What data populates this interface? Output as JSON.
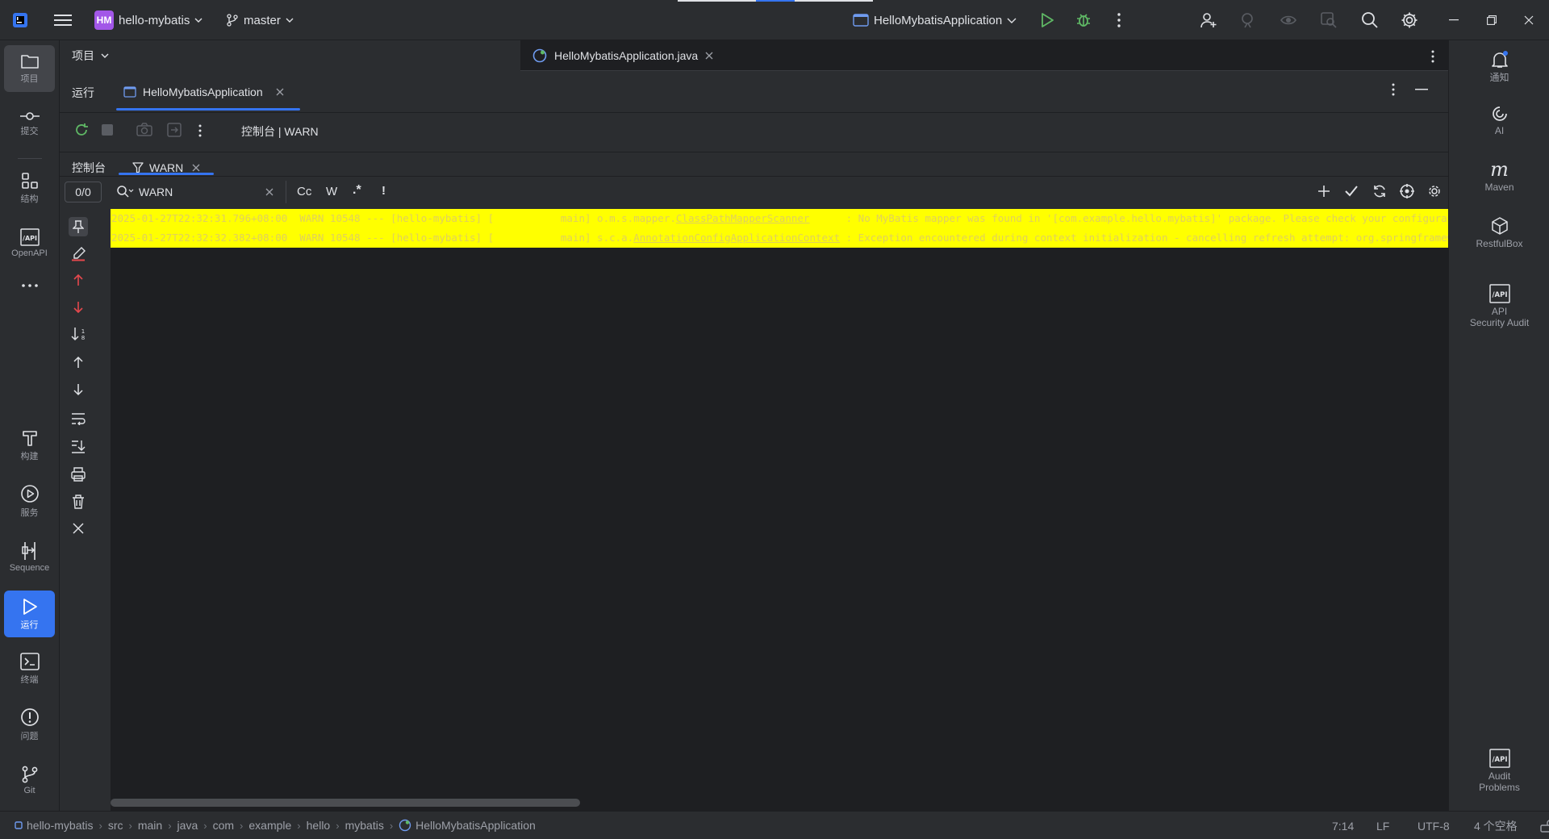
{
  "titlebar": {
    "project_badge": "HM",
    "project_name": "hello-mybatis",
    "branch": "master",
    "run_config": "HelloMybatisApplication"
  },
  "left_tools": [
    {
      "id": "project",
      "label": "项目"
    },
    {
      "id": "commit",
      "label": "提交"
    },
    {
      "id": "structure",
      "label": "结构"
    },
    {
      "id": "openapi",
      "label": "OpenAPI"
    },
    {
      "id": "build",
      "label": "构建"
    },
    {
      "id": "services",
      "label": "服务"
    },
    {
      "id": "sequence",
      "label": "Sequence"
    },
    {
      "id": "run",
      "label": "运行"
    },
    {
      "id": "terminal",
      "label": "终端"
    },
    {
      "id": "problems",
      "label": "问题"
    },
    {
      "id": "git",
      "label": "Git"
    }
  ],
  "right_tools": [
    {
      "id": "notifications",
      "label": "通知"
    },
    {
      "id": "ai",
      "label": "AI"
    },
    {
      "id": "maven",
      "label": "Maven"
    },
    {
      "id": "restfulbox",
      "label": "RestfulBox"
    },
    {
      "id": "api-audit",
      "label": "API\nSecurity Audit"
    },
    {
      "id": "audit-problems",
      "label": "Audit\nProblems"
    }
  ],
  "project_header": {
    "label": "项目"
  },
  "editor_tab": {
    "label": "HelloMybatisApplication.java"
  },
  "run_panel": {
    "title": "运行",
    "tab": "HelloMybatisApplication",
    "toolbar_title": "控制台 | WARN",
    "subtabs": {
      "console": "控制台",
      "filter": "WARN"
    }
  },
  "search": {
    "match_count": "0/0",
    "query": "WARN",
    "opt_case": "Cc",
    "opt_word": "W",
    "opt_regex": ".*",
    "opt_bang": "!"
  },
  "log_lines": [
    {
      "prefix": "2025-01-27T22:32:31.796+08:00  WARN 10548 --- [hello-mybatis] [           main] o.m.s.mapper.",
      "link": "ClassPathMapperScanner",
      "suffix": "      : No MyBatis mapper was found in '[com.example.hello.mybatis]' package. Please check your configuration."
    },
    {
      "prefix": "2025-01-27T22:32:32.382+08:00  WARN 10548 --- [hello-mybatis] [           main] s.c.a.",
      "link": "AnnotationConfigApplicationContext",
      "suffix": " : Exception encountered during context initialization - cancelling refresh attempt: org.springframework"
    }
  ],
  "statusbar": {
    "breadcrumbs": [
      "hello-mybatis",
      "src",
      "main",
      "java",
      "com",
      "example",
      "hello",
      "mybatis",
      "HelloMybatisApplication"
    ],
    "position": "7:14",
    "line_sep": "LF",
    "encoding": "UTF-8",
    "indent": "4 个空格"
  },
  "colors": {
    "accent": "#3574f0",
    "highlight": "#ffff00",
    "bg": "#1e1f22",
    "panel": "#2b2d30"
  }
}
